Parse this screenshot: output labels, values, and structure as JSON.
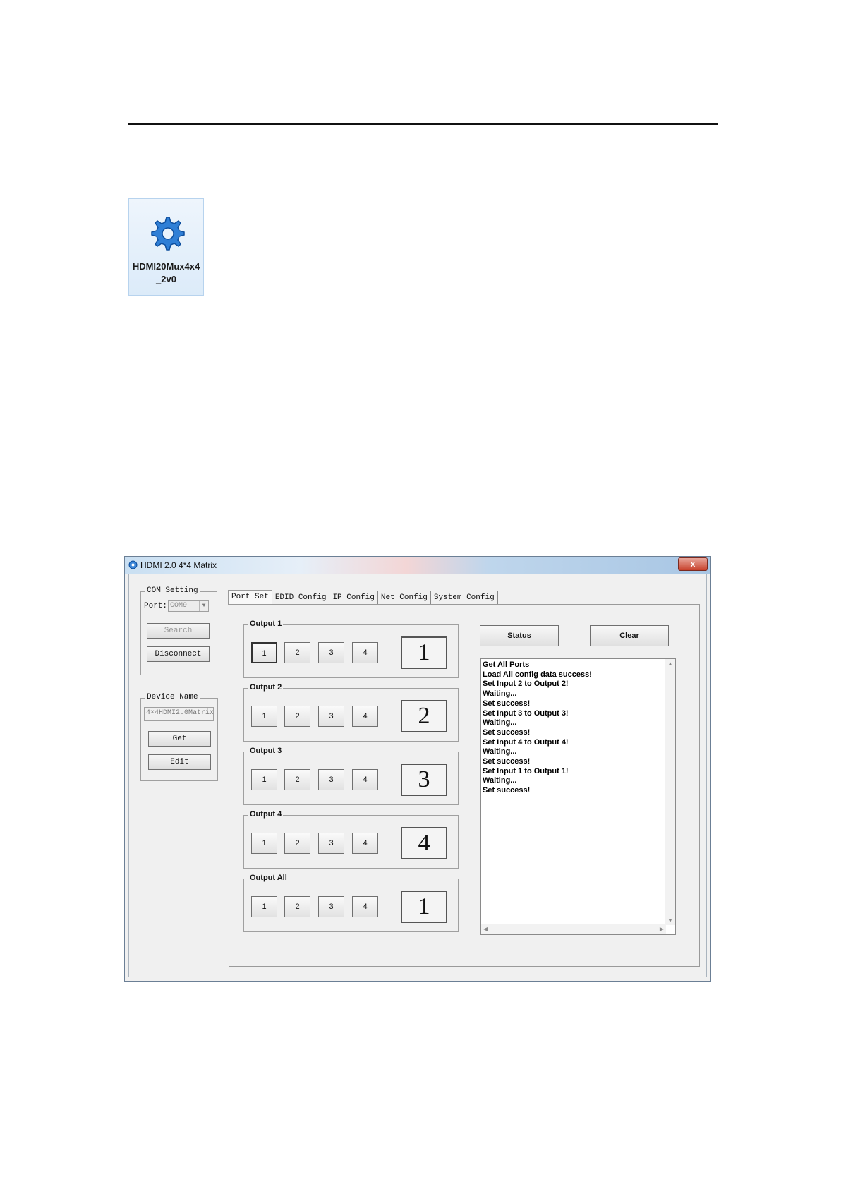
{
  "desktop_icon": {
    "label": "HDMI20Mux4x4\n_2v0",
    "icon": "gear-icon"
  },
  "window": {
    "title": "HDMI 2.0 4*4 Matrix",
    "close_label": "x",
    "com_setting": {
      "title": "COM Setting",
      "port_label": "Port:",
      "port_value": "COM9",
      "search_label": "Search",
      "disconnect_label": "Disconnect"
    },
    "device_name": {
      "title": "Device Name",
      "value": "4×4HDMI2.0Matrix",
      "get_label": "Get",
      "edit_label": "Edit"
    },
    "tabs": [
      "Port Set",
      "EDID Config",
      "IP Config",
      "Net Config",
      "System Config"
    ],
    "outputs": [
      {
        "title": "Output 1",
        "inputs": [
          "1",
          "2",
          "3",
          "4"
        ],
        "current": "1"
      },
      {
        "title": "Output 2",
        "inputs": [
          "1",
          "2",
          "3",
          "4"
        ],
        "current": "2"
      },
      {
        "title": "Output 3",
        "inputs": [
          "1",
          "2",
          "3",
          "4"
        ],
        "current": "3"
      },
      {
        "title": "Output 4",
        "inputs": [
          "1",
          "2",
          "3",
          "4"
        ],
        "current": "4"
      },
      {
        "title": "Output All",
        "inputs": [
          "1",
          "2",
          "3",
          "4"
        ],
        "current": "1"
      }
    ],
    "status_label": "Status",
    "clear_label": "Clear",
    "log": [
      "Get All Ports",
      "Load All config data success!",
      "Set Input 2 to Output 2!",
      "Waiting...",
      "Set success!",
      "Set Input 3 to Output 3!",
      "Waiting...",
      "Set success!",
      "Set Input 4 to Output 4!",
      "Waiting...",
      "Set success!",
      "Set Input 1 to Output 1!",
      "Waiting...",
      "Set success!"
    ]
  }
}
